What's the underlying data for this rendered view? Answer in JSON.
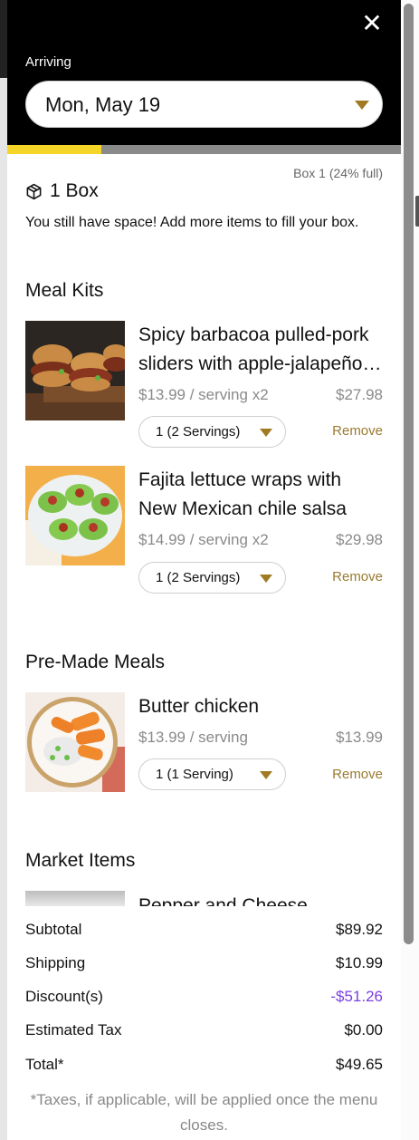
{
  "header": {
    "close_symbol": "✕",
    "arriving_label": "Arriving",
    "date_value": "Mon, May 19"
  },
  "box": {
    "fill_fraction": 0.24,
    "status": "Box 1 (24% full)",
    "title": "1 Box",
    "message": "You still have space! Add more items to fill your box."
  },
  "sections": {
    "meal_kits": "Meal Kits",
    "premade": "Pre-Made Meals",
    "market": "Market Items"
  },
  "meal_kits": [
    {
      "name": "Spicy barbacoa pulled-pork sliders with apple-jalapeño slaw",
      "price": "$13.99 / serving x2",
      "total": "$27.98",
      "quantity": "1 (2 Servings)",
      "remove": "Remove"
    },
    {
      "name": "Fajita lettuce wraps with New Mexican chile salsa",
      "price": "$14.99 / serving x2",
      "total": "$29.98",
      "quantity": "1 (2 Servings)",
      "remove": "Remove"
    }
  ],
  "premade": [
    {
      "name": "Butter chicken",
      "price": "$13.99 / serving",
      "total": "$13.99",
      "quantity": "1 (1 Serving)",
      "remove": "Remove"
    }
  ],
  "market_peek": "Pepper and Cheese Pupusas",
  "summary": {
    "subtotal_label": "Subtotal",
    "subtotal": "$89.92",
    "shipping_label": "Shipping",
    "shipping": "$10.99",
    "discount_label": "Discount(s)",
    "discount": "-$51.26",
    "tax_label": "Estimated Tax",
    "tax": "$0.00",
    "total_label": "Total*",
    "total": "$49.65",
    "tax_note": "*Taxes, if applicable, will be applied once the menu closes."
  },
  "colors": {
    "header_bg": "#000000",
    "progress_fill": "#f4d528",
    "accent_gold": "#a07a22",
    "discount_purple": "#7b3fe0"
  },
  "icons": {
    "close": "close-icon",
    "box": "box-icon",
    "caret": "chevron-down-icon"
  }
}
